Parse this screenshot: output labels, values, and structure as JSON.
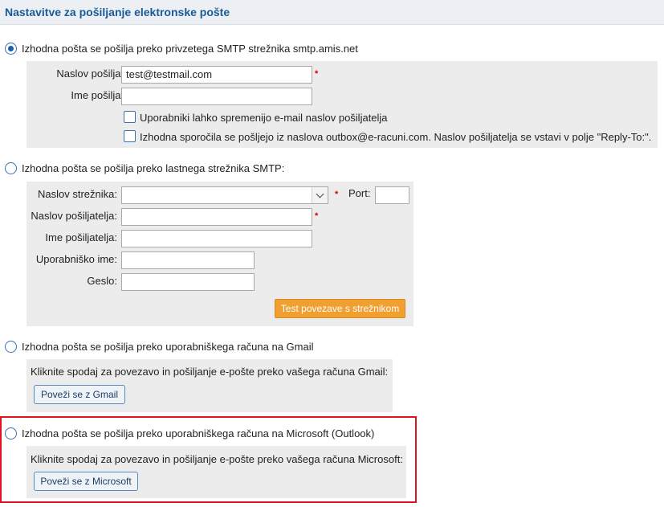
{
  "header": {
    "title": "Nastavitve za pošiljanje elektronske pošte"
  },
  "option_amis": {
    "label": "Izhodna pošta se pošilja preko privzetega SMTP strežnika smtp.amis.net",
    "selected": true,
    "sender_address_label": "Naslov pošiljatelja:",
    "sender_address_value": "test@testmail.com",
    "sender_name_label": "Ime pošiljatelja:",
    "sender_name_value": "",
    "checkbox_users_change": "Uporabniki lahko spremenijo e-mail naslov pošiljatelja",
    "checkbox_outbox": "Izhodna sporočila se pošljejo iz naslova outbox@e-racuni.com. Naslov pošiljatelja se vstavi v polje \"Reply-To:\"."
  },
  "option_own_smtp": {
    "label": "Izhodna pošta se pošilja preko lastnega strežnika SMTP:",
    "selected": false,
    "server_label": "Naslov strežnika:",
    "server_value": "",
    "port_label": "Port:",
    "port_value": "",
    "sender_address_label": "Naslov pošiljatelja:",
    "sender_address_value": "",
    "sender_name_label": "Ime pošiljatelja:",
    "sender_name_value": "",
    "username_label": "Uporabniško ime:",
    "username_value": "",
    "password_label": "Geslo:",
    "password_value": "",
    "test_button": "Test povezave s strežnikom"
  },
  "option_gmail": {
    "label": "Izhodna pošta se pošilja preko uporabniškega računa na Gmail",
    "selected": false,
    "instruction": "Kliknite spodaj za povezavo in pošiljanje e-pošte preko vašega računa Gmail:",
    "button": "Poveži se z Gmail"
  },
  "option_microsoft": {
    "label": "Izhodna pošta se pošilja preko uporabniškega računa na Microsoft (Outlook)",
    "selected": false,
    "instruction": "Kliknite spodaj za povezavo in pošiljanje e-pošte preko vašega računa Microsoft:",
    "button": "Poveži se z Microsoft"
  },
  "required_marker": "*",
  "colors": {
    "accent": "#1a5a96",
    "highlight": "#e0141e",
    "test_button": "#f0a030"
  }
}
